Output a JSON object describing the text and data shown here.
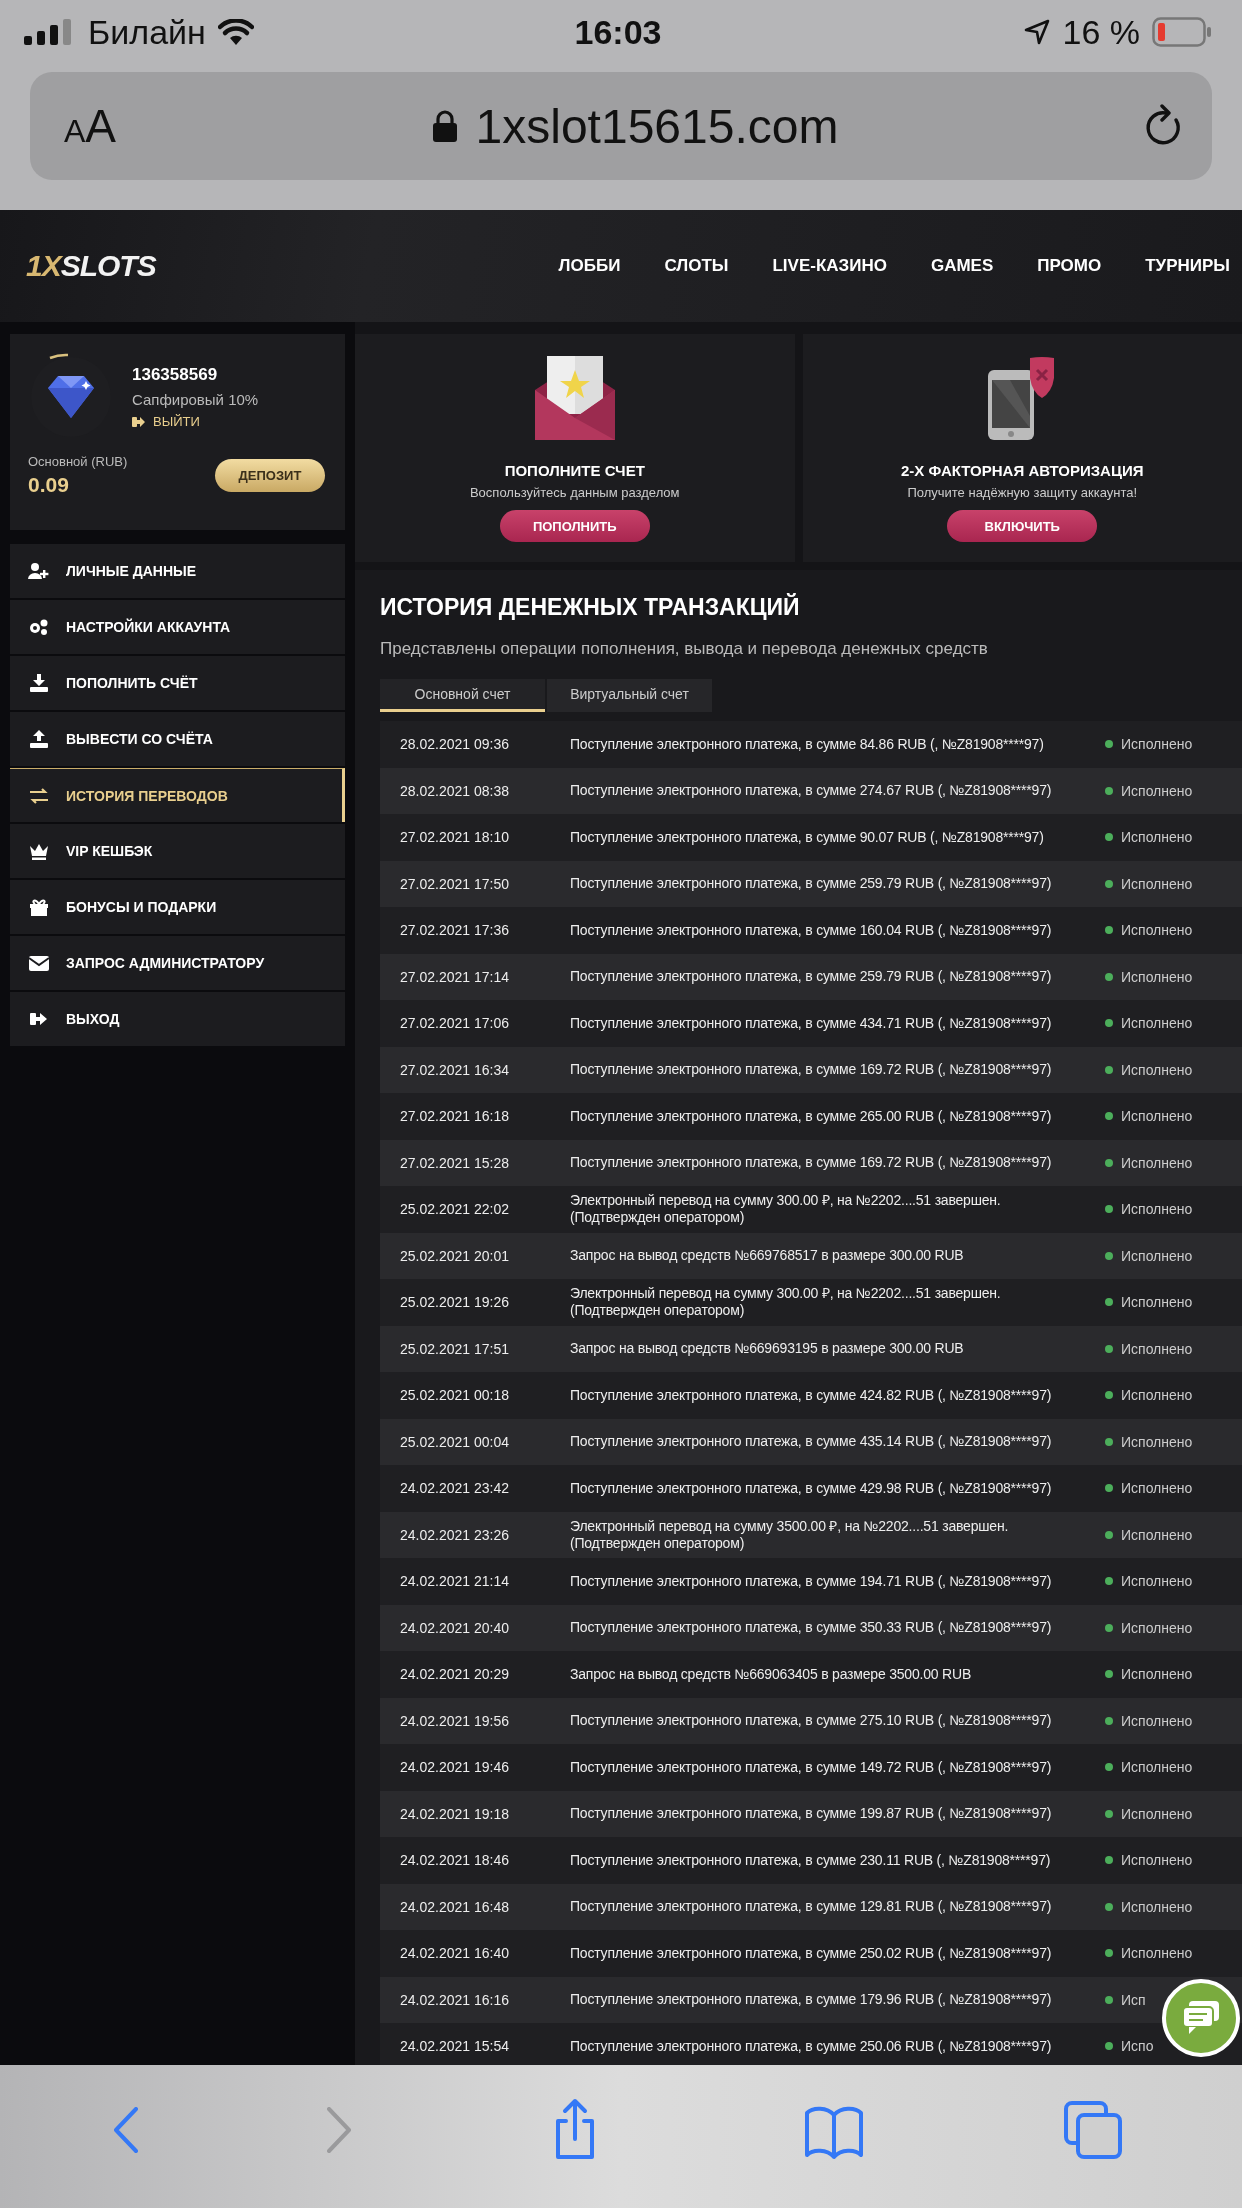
{
  "status_bar": {
    "carrier": "Билайн",
    "time": "16:03",
    "battery": "16 %"
  },
  "address_bar": {
    "reader_button": "AA",
    "url": "1xslot15615.com"
  },
  "site_header": {
    "logo": [
      "1X",
      "SLOTS"
    ],
    "nav": [
      "ЛОББИ",
      "СЛОТЫ",
      "LIVE-КАЗИНО",
      "GAMES",
      "ПРОМО",
      "ТУРНИРЫ"
    ]
  },
  "profile": {
    "account_id": "136358569",
    "tier": "Сапфировый 10%",
    "logout": "ВЫЙТИ",
    "balance_label": "Основной (RUB)",
    "balance": "0.09",
    "deposit_button": "ДЕПОЗИТ"
  },
  "sidebar": {
    "items": [
      {
        "label": "ЛИЧНЫЕ ДАННЫЕ",
        "selected": false
      },
      {
        "label": "НАСТРОЙКИ АККАУНТА",
        "selected": false
      },
      {
        "label": "ПОПОЛНИТЬ СЧЁТ",
        "selected": false
      },
      {
        "label": "ВЫВЕСТИ СО СЧЁТА",
        "selected": false
      },
      {
        "label": "ИСТОРИЯ ПЕРЕВОДОВ",
        "selected": true
      },
      {
        "label": "VIP КЕШБЭК",
        "selected": false
      },
      {
        "label": "БОНУСЫ И ПОДАРКИ",
        "selected": false
      },
      {
        "label": "ЗАПРОС АДМИНИСТРАТОРУ",
        "selected": false
      },
      {
        "label": "ВЫХОД",
        "selected": false
      }
    ]
  },
  "promo_cards": [
    {
      "title": "ПОПОЛНИТЕ СЧЕТ",
      "text": "Воспользуйтесь данным разделом",
      "button": "ПОПОЛНИТЬ"
    },
    {
      "title": "2-Х ФАКТОРНАЯ АВТОРИЗАЦИЯ",
      "text": "Получите надёжную защиту аккаунта!",
      "button": "ВКЛЮЧИТЬ"
    }
  ],
  "history": {
    "title": "ИСТОРИЯ ДЕНЕЖНЫХ ТРАНЗАКЦИЙ",
    "subtitle": "Представлены операции пополнения, вывода и перевода денежных средств",
    "tabs": [
      {
        "label": "Основной счет",
        "selected": true
      },
      {
        "label": "Виртуальный счет",
        "selected": false
      }
    ],
    "rows": [
      {
        "date": "28.02.2021 09:36",
        "description": "Поступление электронного платежа, в сумме 84.86 RUB (, №Z81908****97)",
        "status": "Исполнено"
      },
      {
        "date": "28.02.2021 08:38",
        "description": "Поступление электронного платежа, в сумме 274.67 RUB (, №Z81908****97)",
        "status": "Исполнено"
      },
      {
        "date": "27.02.2021 18:10",
        "description": "Поступление электронного платежа, в сумме 90.07 RUB (, №Z81908****97)",
        "status": "Исполнено"
      },
      {
        "date": "27.02.2021 17:50",
        "description": "Поступление электронного платежа, в сумме 259.79 RUB (, №Z81908****97)",
        "status": "Исполнено"
      },
      {
        "date": "27.02.2021 17:36",
        "description": "Поступление электронного платежа, в сумме 160.04 RUB (, №Z81908****97)",
        "status": "Исполнено"
      },
      {
        "date": "27.02.2021 17:14",
        "description": "Поступление электронного платежа, в сумме 259.79 RUB (, №Z81908****97)",
        "status": "Исполнено"
      },
      {
        "date": "27.02.2021 17:06",
        "description": "Поступление электронного платежа, в сумме 434.71 RUB (, №Z81908****97)",
        "status": "Исполнено"
      },
      {
        "date": "27.02.2021 16:34",
        "description": "Поступление электронного платежа, в сумме 169.72 RUB (, №Z81908****97)",
        "status": "Исполнено"
      },
      {
        "date": "27.02.2021 16:18",
        "description": "Поступление электронного платежа, в сумме 265.00 RUB (, №Z81908****97)",
        "status": "Исполнено"
      },
      {
        "date": "27.02.2021 15:28",
        "description": "Поступление электронного платежа, в сумме 169.72 RUB (, №Z81908****97)",
        "status": "Исполнено"
      },
      {
        "date": "25.02.2021 22:02",
        "description": "Электронный перевод на сумму 300.00 ₽, на №2202....51 завершен.\n(Подтвержден оператором)",
        "status": "Исполнено"
      },
      {
        "date": "25.02.2021 20:01",
        "description": "Запрос на вывод средств №669768517 в размере 300.00 RUB",
        "status": "Исполнено"
      },
      {
        "date": "25.02.2021 19:26",
        "description": "Электронный перевод на сумму 300.00 ₽, на №2202....51 завершен.\n(Подтвержден оператором)",
        "status": "Исполнено"
      },
      {
        "date": "25.02.2021 17:51",
        "description": "Запрос на вывод средств №669693195 в размере 300.00 RUB",
        "status": "Исполнено"
      },
      {
        "date": "25.02.2021 00:18",
        "description": "Поступление электронного платежа, в сумме 424.82 RUB (, №Z81908****97)",
        "status": "Исполнено"
      },
      {
        "date": "25.02.2021 00:04",
        "description": "Поступление электронного платежа, в сумме 435.14 RUB (, №Z81908****97)",
        "status": "Исполнено"
      },
      {
        "date": "24.02.2021 23:42",
        "description": "Поступление электронного платежа, в сумме 429.98 RUB (, №Z81908****97)",
        "status": "Исполнено"
      },
      {
        "date": "24.02.2021 23:26",
        "description": "Электронный перевод на сумму 3500.00 ₽, на №2202....51 завершен.\n(Подтвержден оператором)",
        "status": "Исполнено"
      },
      {
        "date": "24.02.2021 21:14",
        "description": "Поступление электронного платежа, в сумме 194.71 RUB (, №Z81908****97)",
        "status": "Исполнено"
      },
      {
        "date": "24.02.2021 20:40",
        "description": "Поступление электронного платежа, в сумме 350.33 RUB (, №Z81908****97)",
        "status": "Исполнено"
      },
      {
        "date": "24.02.2021 20:29",
        "description": "Запрос на вывод средств №669063405 в размере 3500.00 RUB",
        "status": "Исполнено"
      },
      {
        "date": "24.02.2021 19:56",
        "description": "Поступление электронного платежа, в сумме 275.10 RUB (, №Z81908****97)",
        "status": "Исполнено"
      },
      {
        "date": "24.02.2021 19:46",
        "description": "Поступление электронного платежа, в сумме 149.72 RUB (, №Z81908****97)",
        "status": "Исполнено"
      },
      {
        "date": "24.02.2021 19:18",
        "description": "Поступление электронного платежа, в сумме 199.87 RUB (, №Z81908****97)",
        "status": "Исполнено"
      },
      {
        "date": "24.02.2021 18:46",
        "description": "Поступление электронного платежа, в сумме 230.11 RUB (, №Z81908****97)",
        "status": "Исполнено"
      },
      {
        "date": "24.02.2021 16:48",
        "description": "Поступление электронного платежа, в сумме 129.81 RUB (, №Z81908****97)",
        "status": "Исполнено"
      },
      {
        "date": "24.02.2021 16:40",
        "description": "Поступление электронного платежа, в сумме 250.02 RUB (, №Z81908****97)",
        "status": "Исполнено"
      },
      {
        "date": "24.02.2021 16:16",
        "description": "Поступление электронного платежа, в сумме 179.96 RUB (, №Z81908****97)",
        "status": "Исп"
      },
      {
        "date": "24.02.2021 15:54",
        "description": "Поступление электронного платежа, в сумме 250.06 RUB (, №Z81908****97)",
        "status": "Испо"
      }
    ]
  },
  "toolbar": [
    {
      "kind": "back",
      "disabled": false
    },
    {
      "kind": "forward",
      "disabled": true
    },
    {
      "kind": "share",
      "disabled": false
    },
    {
      "kind": "bookmarks",
      "disabled": false
    },
    {
      "kind": "tabs",
      "disabled": false
    }
  ]
}
